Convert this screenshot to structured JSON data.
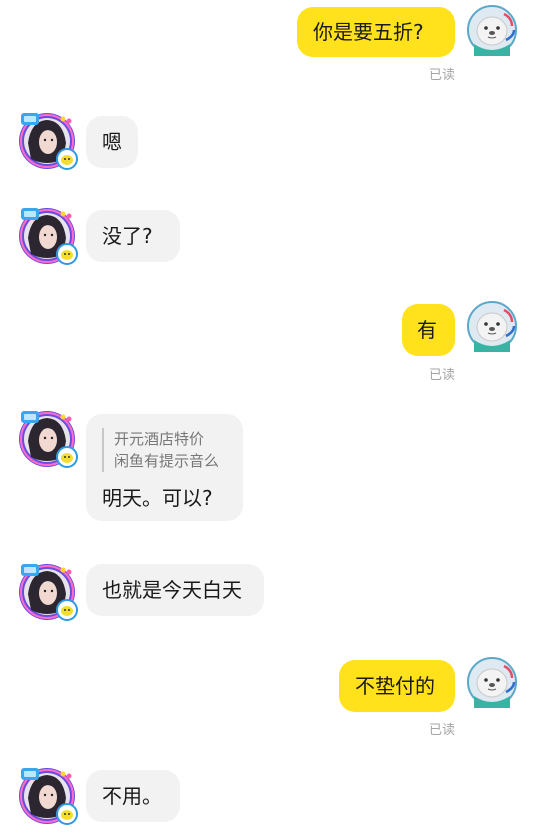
{
  "colors": {
    "my_bubble": "#ffe11c",
    "their_bubble": "#f2f2f2",
    "read_status": "#a5a5a5"
  },
  "messages": [
    {
      "side": "me",
      "text": "你是要五折?",
      "status": "已读"
    },
    {
      "side": "them",
      "text": "嗯"
    },
    {
      "side": "them",
      "text": "没了?"
    },
    {
      "side": "me",
      "text": "有",
      "status": "已读"
    },
    {
      "side": "them",
      "quote_line1": "开元酒店特价",
      "quote_line2": "闲鱼有提示音么",
      "text": "明天。可以?"
    },
    {
      "side": "them",
      "text": "也就是今天白天"
    },
    {
      "side": "me",
      "text": "不垫付的",
      "status": "已读"
    },
    {
      "side": "them",
      "text": "不用。"
    }
  ],
  "icons": {
    "my_avatar": "seal-avatar-icon",
    "their_avatar": "user-photo-avatar-icon"
  }
}
